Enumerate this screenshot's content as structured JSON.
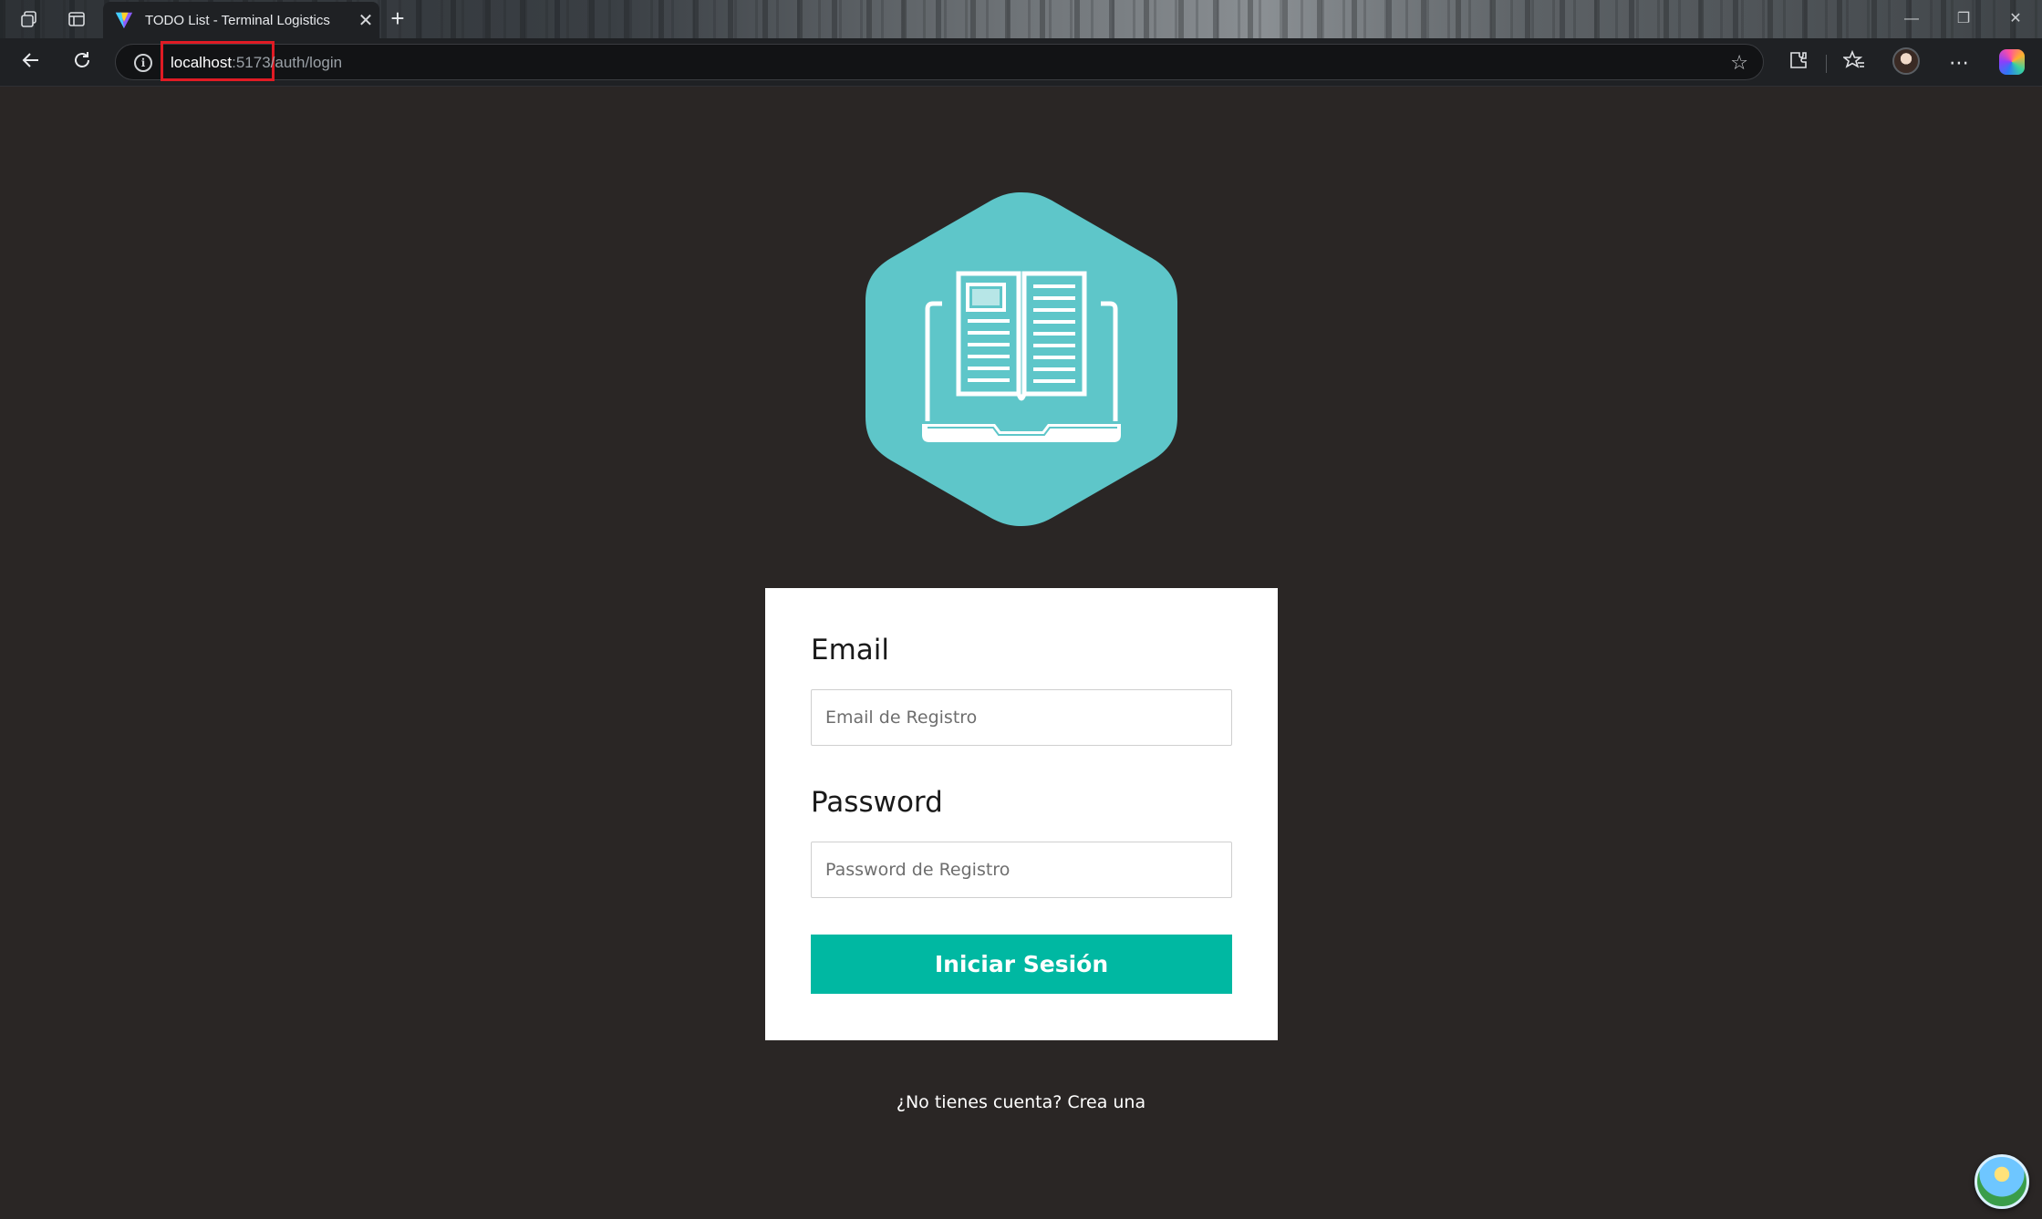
{
  "browser": {
    "tab_title": "TODO List - Terminal Logistics",
    "url_host": "localhost",
    "url_rest": ":5173/auth/login",
    "icons": {
      "workspaces": "workspaces-icon",
      "tab_actions": "tab-actions-icon",
      "new_tab": "plus-icon",
      "back": "back-arrow-icon",
      "refresh": "refresh-icon",
      "site_info": "info-icon",
      "favorite": "star-icon",
      "extensions": "puzzle-icon",
      "favorites": "favorites-icon",
      "menu": "more-icon",
      "copilot": "copilot-icon"
    }
  },
  "login": {
    "email_label": "Email",
    "email_placeholder": "Email de Registro",
    "password_label": "Password",
    "password_placeholder": "Password de Registro",
    "submit_label": "Iniciar Sesión",
    "signup_text": "¿No tienes cuenta? Crea una"
  },
  "colors": {
    "page_background": "#2a2625",
    "logo_hexagon": "#5ec6c9",
    "button": "#00b8a2",
    "url_highlight": "#e01b24"
  }
}
